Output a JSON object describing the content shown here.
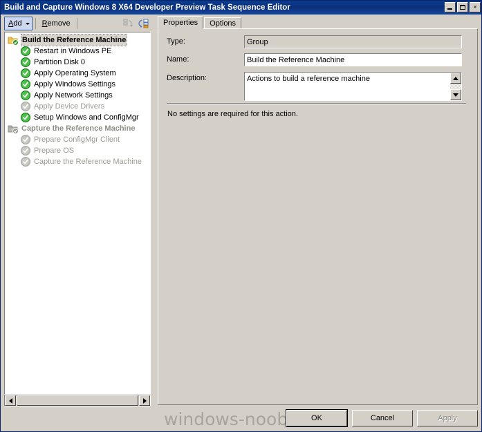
{
  "window": {
    "title": "Build and Capture Windows 8 X64 Developer Preview Task Sequence Editor",
    "controls": {
      "minimize_label": "Minimize",
      "maximize_label": "Maximize",
      "close_label": "×"
    }
  },
  "toolbar": {
    "add_label": "Add",
    "remove_label": "Remove",
    "icon_undo_name": "collapse-all-icon",
    "icon_properties_name": "expand-all-icon"
  },
  "tree": {
    "items": [
      {
        "label": "Build the Reference Machine",
        "type": "group",
        "indent": 0,
        "state": "enabled",
        "selected": true,
        "icon": "folder-check-icon"
      },
      {
        "label": "Restart in Windows PE",
        "type": "action",
        "indent": 1,
        "state": "enabled",
        "selected": false,
        "icon": "check-circle-icon"
      },
      {
        "label": "Partition Disk 0",
        "type": "action",
        "indent": 1,
        "state": "enabled",
        "selected": false,
        "icon": "check-circle-icon"
      },
      {
        "label": "Apply Operating System",
        "type": "action",
        "indent": 1,
        "state": "enabled",
        "selected": false,
        "icon": "check-circle-icon"
      },
      {
        "label": "Apply Windows Settings",
        "type": "action",
        "indent": 1,
        "state": "enabled",
        "selected": false,
        "icon": "check-circle-icon"
      },
      {
        "label": "Apply Network Settings",
        "type": "action",
        "indent": 1,
        "state": "enabled",
        "selected": false,
        "icon": "check-circle-icon"
      },
      {
        "label": "Apply Device Drivers",
        "type": "action",
        "indent": 1,
        "state": "disabled",
        "selected": false,
        "icon": "check-circle-icon"
      },
      {
        "label": "Setup Windows and ConfigMgr",
        "type": "action",
        "indent": 1,
        "state": "enabled",
        "selected": false,
        "icon": "check-circle-icon"
      },
      {
        "label": "Capture the Reference Machine",
        "type": "group",
        "indent": 0,
        "state": "disabled",
        "selected": false,
        "icon": "folder-check-icon"
      },
      {
        "label": "Prepare ConfigMgr Client",
        "type": "action",
        "indent": 1,
        "state": "disabled",
        "selected": false,
        "icon": "check-circle-icon"
      },
      {
        "label": "Prepare OS",
        "type": "action",
        "indent": 1,
        "state": "disabled",
        "selected": false,
        "icon": "check-circle-icon"
      },
      {
        "label": "Capture the Reference Machine",
        "type": "action",
        "indent": 1,
        "state": "disabled",
        "selected": false,
        "icon": "check-circle-icon"
      }
    ],
    "scroll_left_icon": "scroll-left-arrow-icon",
    "scroll_right_icon": "scroll-right-arrow-icon"
  },
  "tabs": [
    {
      "label": "Properties",
      "active": true
    },
    {
      "label": "Options",
      "active": false
    }
  ],
  "form": {
    "type": {
      "label": "Type:",
      "value": "Group",
      "readonly": true
    },
    "name": {
      "label": "Name:",
      "value": "Build the Reference Machine",
      "readonly": false
    },
    "description": {
      "label": "Description:",
      "value": "Actions to build a reference machine",
      "readonly": false
    },
    "note": "No settings are required  for this action."
  },
  "watermark": {
    "text": "windows-noob.com"
  },
  "buttons": {
    "ok": {
      "label": "OK",
      "state": "default"
    },
    "cancel": {
      "label": "Cancel",
      "state": "enabled"
    },
    "apply": {
      "label": "Apply",
      "state": "disabled"
    }
  },
  "colors": {
    "titlebar": "#0a2f7a",
    "panel": "#d4d0c8",
    "field": "#ffffff",
    "accent_green": "#2e9b2e",
    "disabled_text": "#9a9a94"
  }
}
